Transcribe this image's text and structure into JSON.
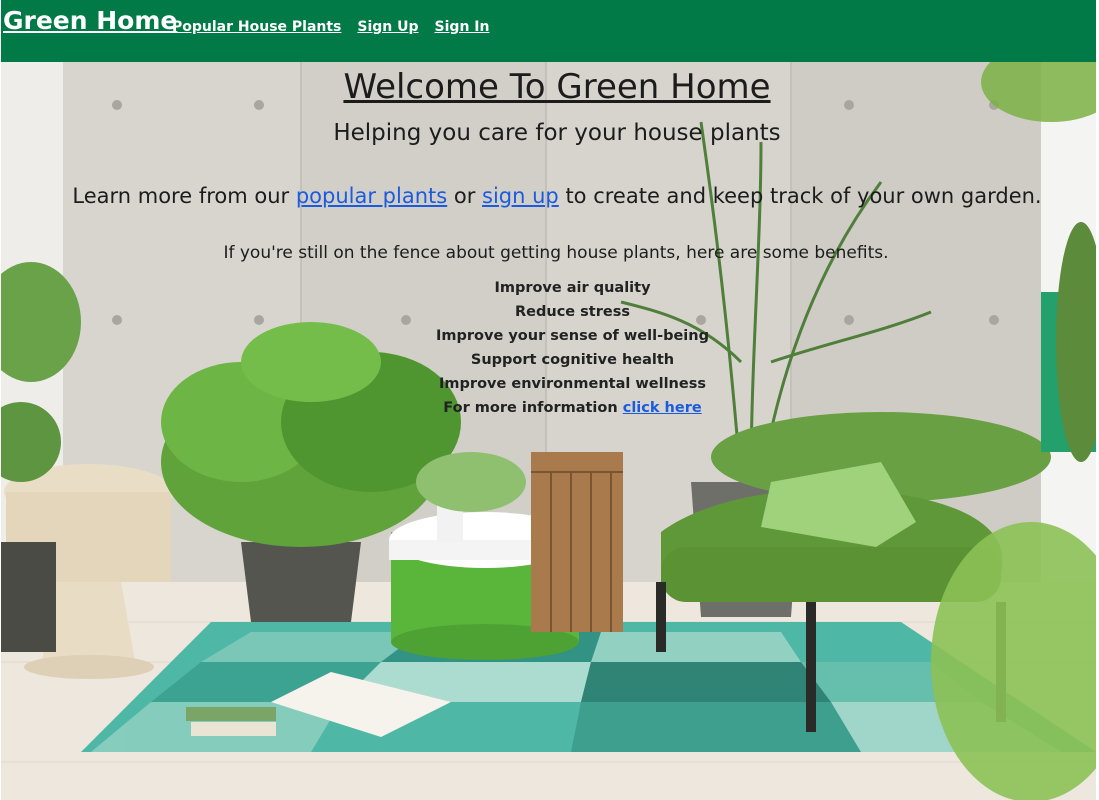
{
  "nav": {
    "brand": "Green Home",
    "links": [
      "Popular House Plants",
      "Sign Up",
      "Sign In"
    ]
  },
  "hero": {
    "title": "Welcome To Green Home",
    "subtitle": "Helping you care for your house plants",
    "learn": {
      "prefix": "Learn more from our ",
      "link1": "popular plants",
      "middle": " or ",
      "link2": "sign up",
      "suffix": " to create and keep track of your own garden."
    },
    "fence_text": "If you're still on the fence about getting house plants, here are some benefits.",
    "benefits": [
      "Improve air quality",
      "Reduce stress",
      "Improve your sense of well-being",
      "Support cognitive health",
      "Improve environmental wellness"
    ],
    "more_info": {
      "prefix": "For more information ",
      "link": "click here"
    }
  },
  "colors": {
    "navbar": "#027a48",
    "link": "#1a5be0"
  }
}
